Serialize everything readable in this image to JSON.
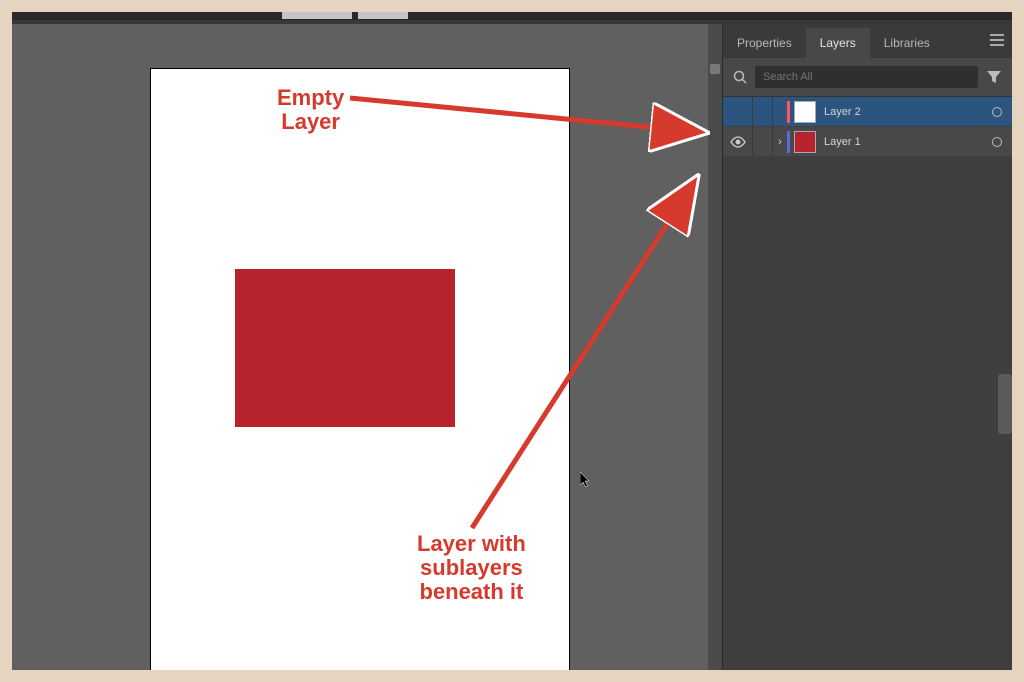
{
  "tabs": {
    "properties": "Properties",
    "layers": "Layers",
    "libraries": "Libraries"
  },
  "search": {
    "placeholder": "Search All"
  },
  "layers": [
    {
      "name": "Layer 2",
      "color": "#ff5555",
      "thumb": "#ffffff",
      "visible": false,
      "expandable": false,
      "selected": true
    },
    {
      "name": "Layer 1",
      "color": "#5a6bd8",
      "thumb": "#b7232c",
      "visible": true,
      "expandable": true,
      "selected": false
    }
  ],
  "annotations": {
    "empty1": "Empty",
    "empty2": "Layer",
    "sub1": "Layer with",
    "sub2": "sublayers",
    "sub3": "beneath it"
  },
  "canvas": {
    "rect_color": "#b7232c"
  }
}
